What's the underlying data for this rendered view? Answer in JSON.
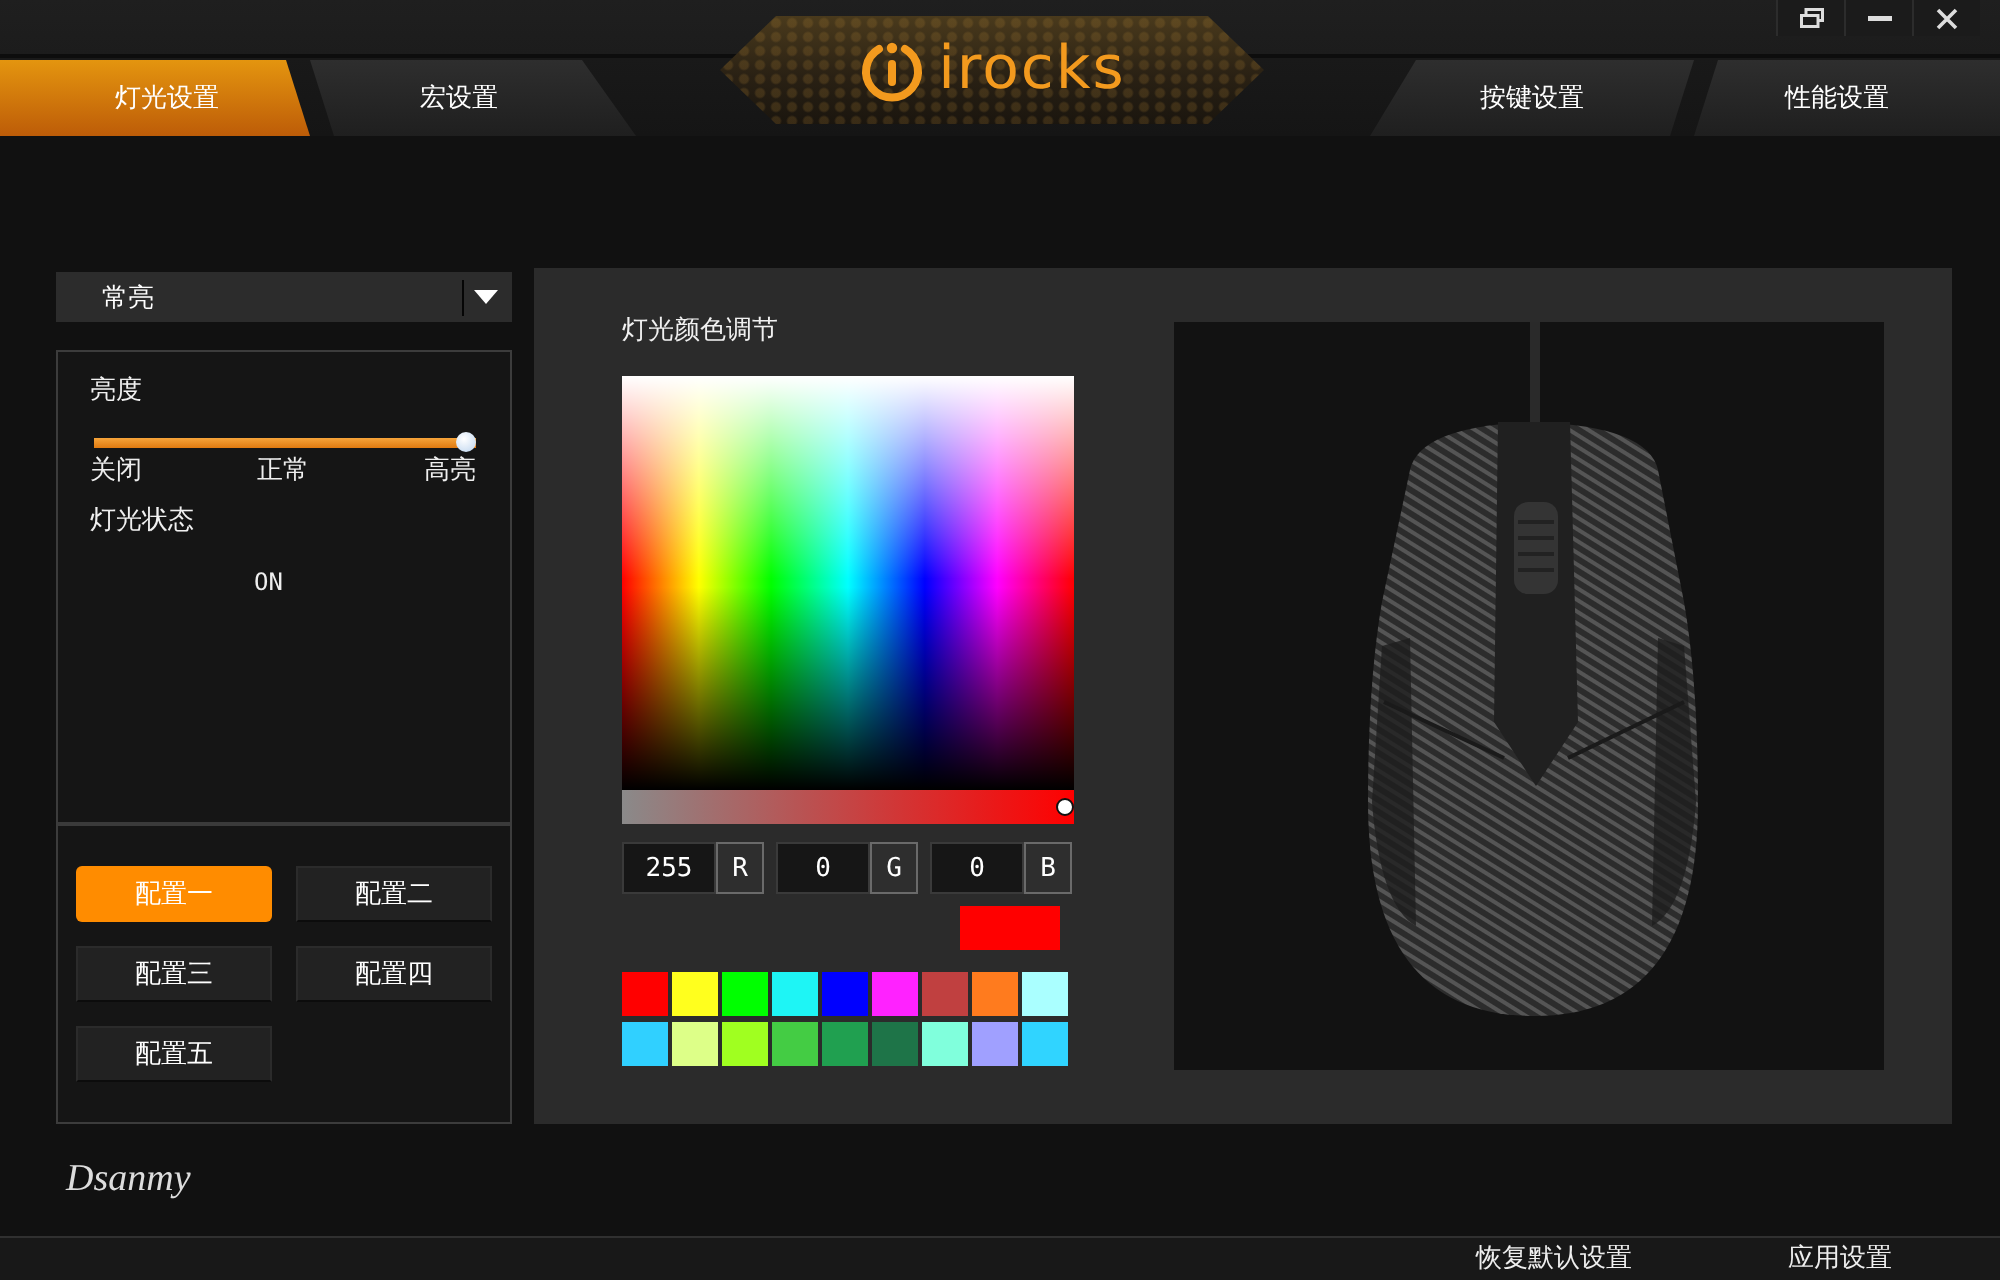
{
  "window": {
    "logo": "irocks"
  },
  "tabs": [
    {
      "label": "灯光设置",
      "selected": true
    },
    {
      "label": "宏设置",
      "selected": false
    },
    {
      "label": "按键设置",
      "selected": false
    },
    {
      "label": "性能设置",
      "selected": false
    }
  ],
  "lighting": {
    "mode_dropdown": {
      "value": "常亮"
    },
    "brightness": {
      "label": "亮度",
      "level": 1,
      "ticks": [
        "关闭",
        "正常",
        "高亮"
      ]
    },
    "status": {
      "label": "灯光状态",
      "value": "ON"
    }
  },
  "profiles": [
    {
      "label": "配置一",
      "selected": true
    },
    {
      "label": "配置二",
      "selected": false
    },
    {
      "label": "配置三",
      "selected": false
    },
    {
      "label": "配置四",
      "selected": false
    },
    {
      "label": "配置五",
      "selected": false
    }
  ],
  "color_panel": {
    "title": "灯光颜色调节",
    "saturation": {
      "level": 1
    },
    "channels": [
      {
        "value": "255",
        "label": "R"
      },
      {
        "value": "0",
        "label": "G"
      },
      {
        "value": "0",
        "label": "B"
      }
    ],
    "preview": {
      "color": "#ff0000"
    },
    "swatches": [
      {
        "color": "#ff0000"
      },
      {
        "color": "#ffff1e"
      },
      {
        "color": "#00ff00"
      },
      {
        "color": "#1ef5f5"
      },
      {
        "color": "#0000ff"
      },
      {
        "color": "#ff22ff"
      },
      {
        "color": "#c04040"
      },
      {
        "color": "#ff7b1e"
      },
      {
        "color": "#aaffff"
      },
      {
        "color": "#30d0ff"
      },
      {
        "color": "#ddff88"
      },
      {
        "color": "#a0ff20"
      },
      {
        "color": "#44cc44"
      },
      {
        "color": "#20a050"
      },
      {
        "color": "#1e7448"
      },
      {
        "color": "#80ffdc"
      },
      {
        "color": "#a0a0ff"
      },
      {
        "color": "#30d4ff"
      }
    ]
  },
  "signature": "Dsanmy",
  "reset_button": {
    "label": "恢复默认设置"
  },
  "apply_button": {
    "label": "应用设置"
  }
}
